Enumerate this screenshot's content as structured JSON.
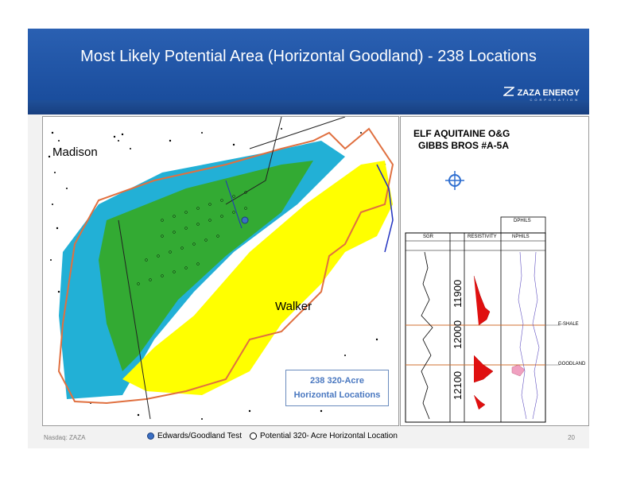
{
  "slide": {
    "title": "Most Likely Potential Area (Horizontal Goodland) - 238 Locations",
    "logo_text": "ZAZA ENERGY",
    "logo_subtext": "CORPORATION",
    "footer_left": "Nasdaq: ZAZA",
    "page_number": "20",
    "legend": {
      "edwards": "Edwards/Goodland Test",
      "potential": "Potential 320- Acre Horizontal Location"
    },
    "colors": {
      "header": "#1f5aa8",
      "cyan": "#22b0d6",
      "green": "#33aa33",
      "yellow": "#ffff00",
      "outline": "#e07040"
    }
  },
  "map": {
    "county_madison": "Madison",
    "county_walker": "Walker",
    "callout_line1": "238 320-Acre",
    "callout_line2": "Horizontal Locations"
  },
  "log": {
    "operator": "ELF AQUITAINE O&G",
    "well": "GIBBS BROS #A-5A",
    "track_sgr": "SGR",
    "track_resistivity": "RESISTIVITY",
    "track_nphi": "NPHILS",
    "track_dphi": "DPHILS",
    "depths": [
      "11900",
      "12000",
      "12100"
    ],
    "marker_eshale": "E-SHALE",
    "marker_goodland": "GOODLAND"
  }
}
